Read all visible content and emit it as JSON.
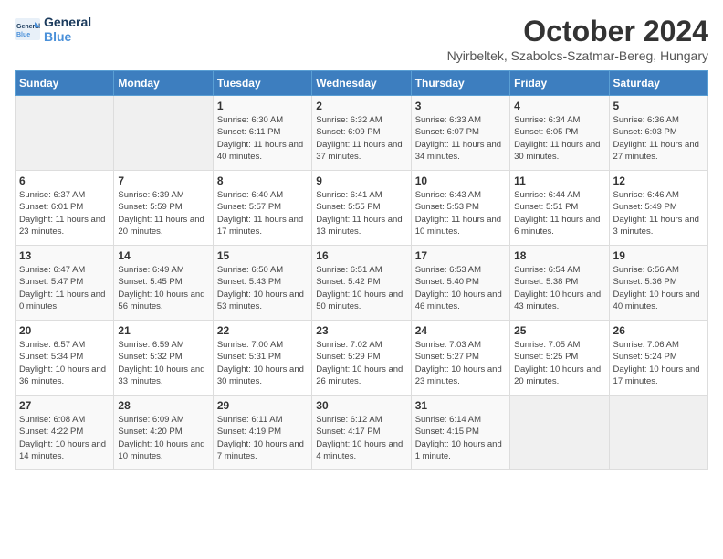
{
  "header": {
    "logo_line1": "General",
    "logo_line2": "Blue",
    "month": "October 2024",
    "location": "Nyirbeltek, Szabolcs-Szatmar-Bereg, Hungary"
  },
  "days_of_week": [
    "Sunday",
    "Monday",
    "Tuesday",
    "Wednesday",
    "Thursday",
    "Friday",
    "Saturday"
  ],
  "weeks": [
    [
      {
        "day": "",
        "info": ""
      },
      {
        "day": "",
        "info": ""
      },
      {
        "day": "1",
        "info": "Sunrise: 6:30 AM\nSunset: 6:11 PM\nDaylight: 11 hours and 40 minutes."
      },
      {
        "day": "2",
        "info": "Sunrise: 6:32 AM\nSunset: 6:09 PM\nDaylight: 11 hours and 37 minutes."
      },
      {
        "day": "3",
        "info": "Sunrise: 6:33 AM\nSunset: 6:07 PM\nDaylight: 11 hours and 34 minutes."
      },
      {
        "day": "4",
        "info": "Sunrise: 6:34 AM\nSunset: 6:05 PM\nDaylight: 11 hours and 30 minutes."
      },
      {
        "day": "5",
        "info": "Sunrise: 6:36 AM\nSunset: 6:03 PM\nDaylight: 11 hours and 27 minutes."
      }
    ],
    [
      {
        "day": "6",
        "info": "Sunrise: 6:37 AM\nSunset: 6:01 PM\nDaylight: 11 hours and 23 minutes."
      },
      {
        "day": "7",
        "info": "Sunrise: 6:39 AM\nSunset: 5:59 PM\nDaylight: 11 hours and 20 minutes."
      },
      {
        "day": "8",
        "info": "Sunrise: 6:40 AM\nSunset: 5:57 PM\nDaylight: 11 hours and 17 minutes."
      },
      {
        "day": "9",
        "info": "Sunrise: 6:41 AM\nSunset: 5:55 PM\nDaylight: 11 hours and 13 minutes."
      },
      {
        "day": "10",
        "info": "Sunrise: 6:43 AM\nSunset: 5:53 PM\nDaylight: 11 hours and 10 minutes."
      },
      {
        "day": "11",
        "info": "Sunrise: 6:44 AM\nSunset: 5:51 PM\nDaylight: 11 hours and 6 minutes."
      },
      {
        "day": "12",
        "info": "Sunrise: 6:46 AM\nSunset: 5:49 PM\nDaylight: 11 hours and 3 minutes."
      }
    ],
    [
      {
        "day": "13",
        "info": "Sunrise: 6:47 AM\nSunset: 5:47 PM\nDaylight: 11 hours and 0 minutes."
      },
      {
        "day": "14",
        "info": "Sunrise: 6:49 AM\nSunset: 5:45 PM\nDaylight: 10 hours and 56 minutes."
      },
      {
        "day": "15",
        "info": "Sunrise: 6:50 AM\nSunset: 5:43 PM\nDaylight: 10 hours and 53 minutes."
      },
      {
        "day": "16",
        "info": "Sunrise: 6:51 AM\nSunset: 5:42 PM\nDaylight: 10 hours and 50 minutes."
      },
      {
        "day": "17",
        "info": "Sunrise: 6:53 AM\nSunset: 5:40 PM\nDaylight: 10 hours and 46 minutes."
      },
      {
        "day": "18",
        "info": "Sunrise: 6:54 AM\nSunset: 5:38 PM\nDaylight: 10 hours and 43 minutes."
      },
      {
        "day": "19",
        "info": "Sunrise: 6:56 AM\nSunset: 5:36 PM\nDaylight: 10 hours and 40 minutes."
      }
    ],
    [
      {
        "day": "20",
        "info": "Sunrise: 6:57 AM\nSunset: 5:34 PM\nDaylight: 10 hours and 36 minutes."
      },
      {
        "day": "21",
        "info": "Sunrise: 6:59 AM\nSunset: 5:32 PM\nDaylight: 10 hours and 33 minutes."
      },
      {
        "day": "22",
        "info": "Sunrise: 7:00 AM\nSunset: 5:31 PM\nDaylight: 10 hours and 30 minutes."
      },
      {
        "day": "23",
        "info": "Sunrise: 7:02 AM\nSunset: 5:29 PM\nDaylight: 10 hours and 26 minutes."
      },
      {
        "day": "24",
        "info": "Sunrise: 7:03 AM\nSunset: 5:27 PM\nDaylight: 10 hours and 23 minutes."
      },
      {
        "day": "25",
        "info": "Sunrise: 7:05 AM\nSunset: 5:25 PM\nDaylight: 10 hours and 20 minutes."
      },
      {
        "day": "26",
        "info": "Sunrise: 7:06 AM\nSunset: 5:24 PM\nDaylight: 10 hours and 17 minutes."
      }
    ],
    [
      {
        "day": "27",
        "info": "Sunrise: 6:08 AM\nSunset: 4:22 PM\nDaylight: 10 hours and 14 minutes."
      },
      {
        "day": "28",
        "info": "Sunrise: 6:09 AM\nSunset: 4:20 PM\nDaylight: 10 hours and 10 minutes."
      },
      {
        "day": "29",
        "info": "Sunrise: 6:11 AM\nSunset: 4:19 PM\nDaylight: 10 hours and 7 minutes."
      },
      {
        "day": "30",
        "info": "Sunrise: 6:12 AM\nSunset: 4:17 PM\nDaylight: 10 hours and 4 minutes."
      },
      {
        "day": "31",
        "info": "Sunrise: 6:14 AM\nSunset: 4:15 PM\nDaylight: 10 hours and 1 minute."
      },
      {
        "day": "",
        "info": ""
      },
      {
        "day": "",
        "info": ""
      }
    ]
  ]
}
